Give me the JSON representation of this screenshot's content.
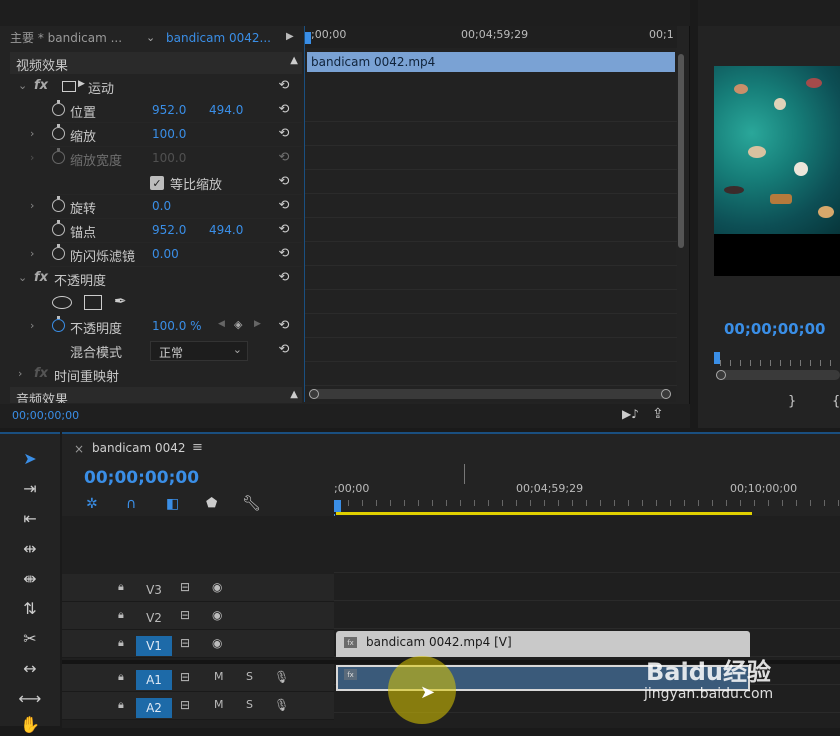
{
  "effect_controls": {
    "tab_master": "主要 * bandicam ...",
    "tab_clip": "bandicam 0042...",
    "section_video": "视频效果",
    "section_audio": "音频效果",
    "mini_ruler": {
      "t0": ";00;00",
      "t1": "00;04;59;29",
      "t2": "00;1"
    },
    "clip_label": "bandicam 0042.mp4",
    "footer_time": "00;00;00;00",
    "motion": {
      "name": "运动",
      "position": {
        "label": "位置",
        "x": "952.0",
        "y": "494.0"
      },
      "scale": {
        "label": "缩放",
        "value": "100.0"
      },
      "scale_width": {
        "label": "缩放宽度",
        "value": "100.0"
      },
      "uniform_scale": {
        "label": "等比缩放",
        "checked": true
      },
      "rotation": {
        "label": "旋转",
        "value": "0.0"
      },
      "anchor": {
        "label": "锚点",
        "x": "952.0",
        "y": "494.0"
      },
      "antiflicker": {
        "label": "防闪烁滤镜",
        "value": "0.00"
      }
    },
    "opacity": {
      "name": "不透明度",
      "opacity": {
        "label": "不透明度",
        "value": "100.0 %"
      },
      "blend": {
        "label": "混合模式",
        "value": "正常"
      }
    },
    "time_remap": {
      "name": "时间重映射"
    }
  },
  "program_monitor": {
    "timecode": "00;00;00;00"
  },
  "timeline": {
    "close": "×",
    "sequence_name": "bandicam 0042",
    "menu": "≡",
    "timecode": "00;00;00;00",
    "ruler": {
      "t0": ";00;00",
      "t1": "00;04;59;29",
      "t2": "00;10;00;00"
    },
    "tracks": [
      {
        "name": "V3",
        "active": false,
        "kind": "video"
      },
      {
        "name": "V2",
        "active": false,
        "kind": "video"
      },
      {
        "name": "V1",
        "active": true,
        "kind": "video"
      },
      {
        "name": "A1",
        "active": true,
        "kind": "audio",
        "m": "M",
        "s": "S"
      },
      {
        "name": "A2",
        "active": true,
        "kind": "audio",
        "m": "M",
        "s": "S"
      }
    ],
    "video_clip_label": "bandicam 0042.mp4 [V]",
    "fx_badge": "fx"
  },
  "watermark": {
    "brand": "Baidu经验",
    "url": "jingyan.baidu.com"
  },
  "colors": {
    "accent": "#3a8ee6",
    "track_active": "#1d6aa8",
    "clip_video": "#c9c9c9",
    "clip_audio": "#3a5a7a",
    "work_area": "#e0d000"
  }
}
